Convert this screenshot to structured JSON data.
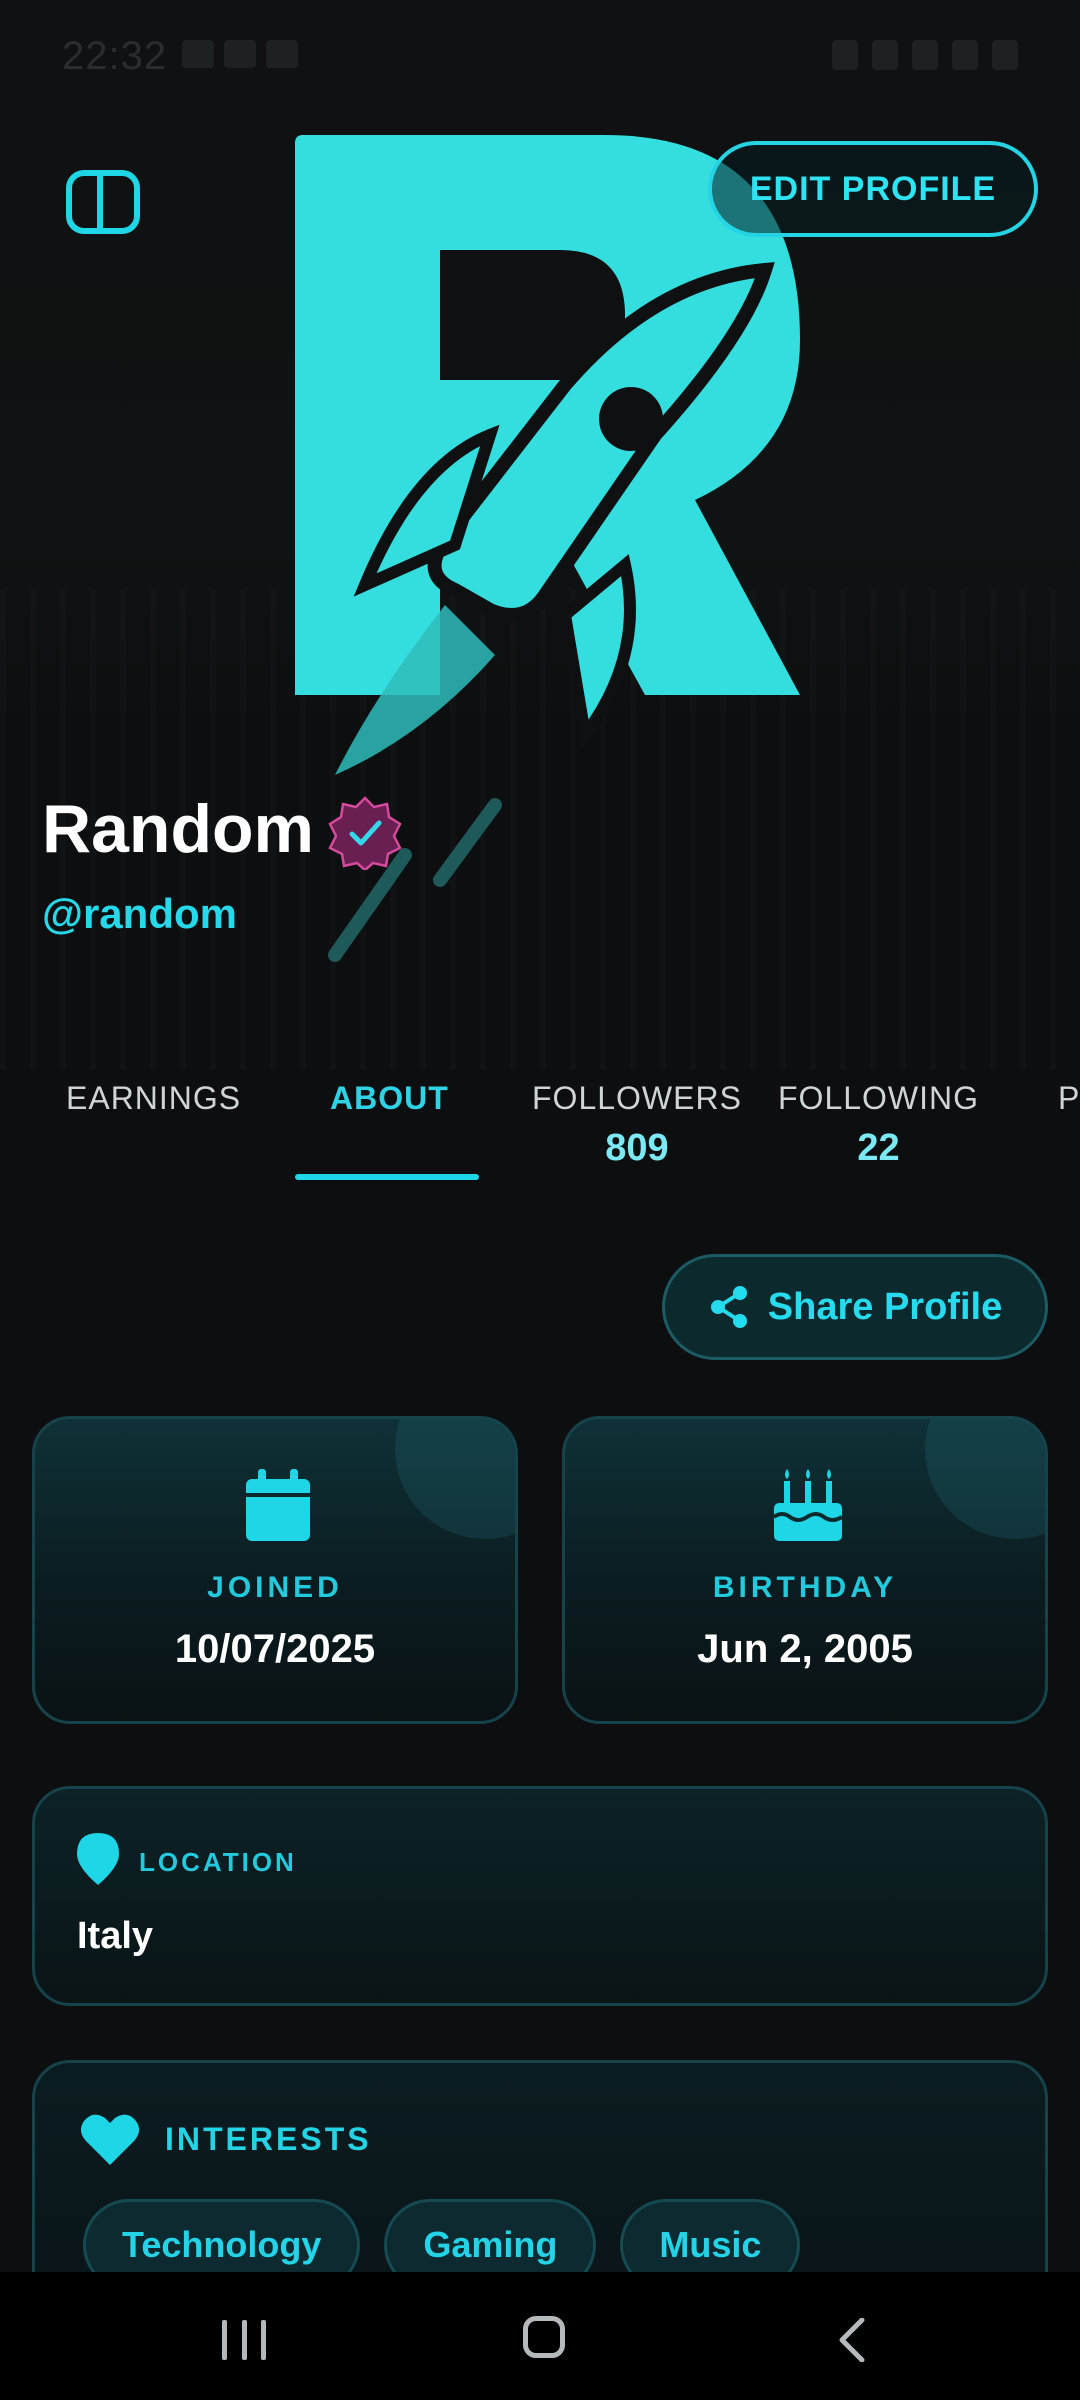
{
  "status_bar": {
    "time": "22:32"
  },
  "header": {
    "edit_profile_label": "EDIT PROFILE"
  },
  "profile": {
    "name": "Random",
    "handle": "@random"
  },
  "tabs": [
    {
      "label": "EARNINGS",
      "count": ""
    },
    {
      "label": "ABOUT",
      "count": ""
    },
    {
      "label": "FOLLOWERS",
      "count": "809"
    },
    {
      "label": "FOLLOWING",
      "count": "22"
    },
    {
      "label": "P",
      "count": ""
    }
  ],
  "share": {
    "label": "Share Profile"
  },
  "joined": {
    "label": "JOINED",
    "value": "10/07/2025",
    "icon": "calendar-icon"
  },
  "birthday": {
    "label": "BIRTHDAY",
    "value": "Jun 2, 2005",
    "icon": "birthday-cake-icon"
  },
  "location": {
    "label": "LOCATION",
    "value": "Italy",
    "icon": "map-pin-icon"
  },
  "interests": {
    "label": "INTERESTS",
    "icon": "heart-icon",
    "items": [
      "Technology",
      "Gaming",
      "Music"
    ]
  },
  "colors": {
    "accent": "#1fd6e6",
    "background": "#0c0e0f",
    "logo": "#35dede",
    "verified_badge": "#6a1f52"
  }
}
